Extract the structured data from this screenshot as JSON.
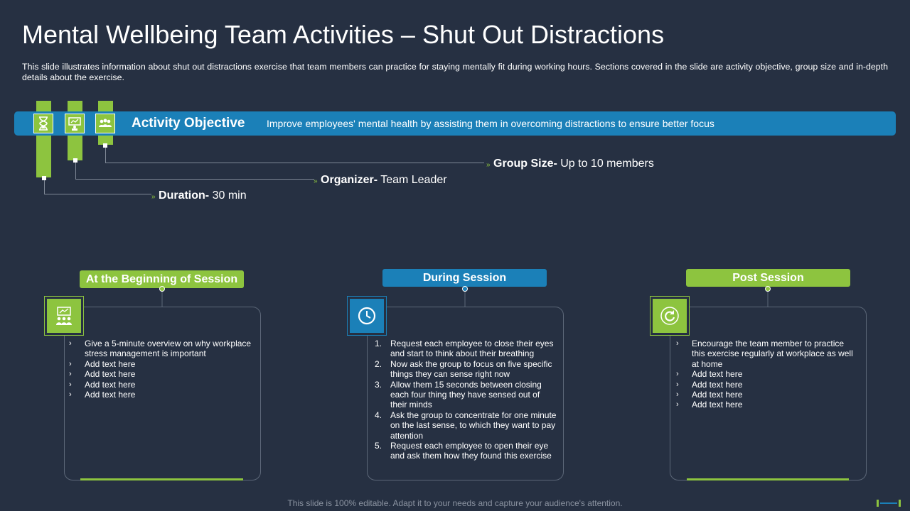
{
  "title": "Mental Wellbeing Team Activities – Shut Out Distractions",
  "subtitle": "This slide illustrates information about shut out distractions exercise that team members can practice for staying mentally fit during working hours. Sections covered in the slide are activity objective, group size and in-depth details about the exercise.",
  "objective": {
    "label": "Activity Objective",
    "text": "Improve employees' mental health by assisting them in overcoming distractions to ensure better focus",
    "icons": [
      "hourglass-icon",
      "presentation-icon",
      "team-icon"
    ]
  },
  "details": {
    "group_size": {
      "label": "Group Size-",
      "value": " Up to 10 members"
    },
    "organizer": {
      "label": "Organizer-",
      "value": " Team Leader"
    },
    "duration": {
      "label": "Duration-",
      "value": " 30 min"
    }
  },
  "sessions": [
    {
      "title": "At the Beginning of Session",
      "icon": "meeting-icon",
      "marker": "›",
      "items": [
        "Give a 5-minute overview on why workplace stress management is important",
        "Add text here",
        "Add text here",
        "Add text here",
        "Add text here"
      ]
    },
    {
      "title": "During Session",
      "icon": "clock-icon",
      "items": [
        "Request each employee to close their eyes and start to think about their breathing",
        "Now ask the group to focus on five specific things they can sense right now",
        "Allow them 15 seconds between closing each four thing they have sensed out of their minds",
        "Ask the group to concentrate for one minute on the last sense, to which they want to pay attention",
        "Request each employee to open their eye and ask them how they found this exercise"
      ],
      "numbers": [
        "1.",
        "2.",
        "3.",
        "4.",
        "5."
      ]
    },
    {
      "title": "Post Session",
      "icon": "refresh-icon",
      "marker": "›",
      "items": [
        "Encourage the team member to practice this exercise regularly at workplace as well at home",
        "Add text here",
        "Add text here",
        "Add text here",
        "Add text here"
      ]
    }
  ],
  "footer": "This slide is 100% editable. Adapt it to your needs and capture your audience's attention.",
  "colors": {
    "background": "#263042",
    "green": "#8dc43f",
    "blue": "#1b80b8"
  }
}
